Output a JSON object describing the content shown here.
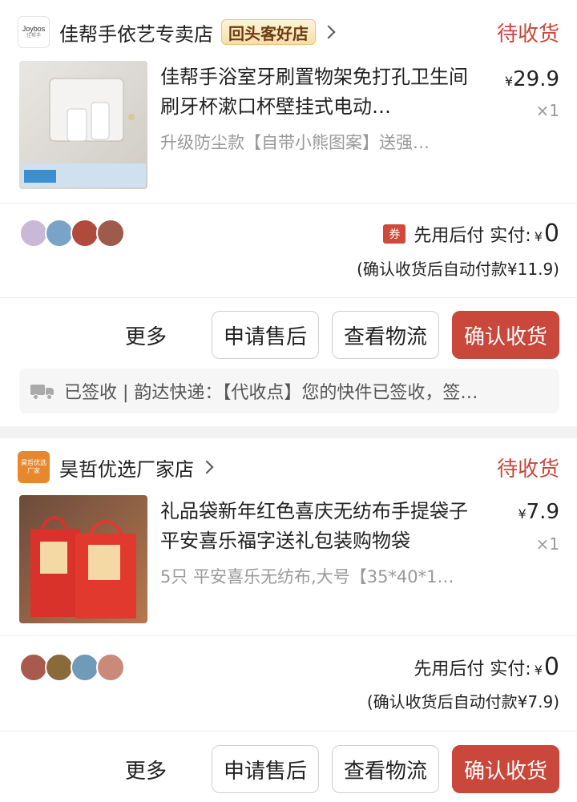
{
  "orders": [
    {
      "store": {
        "name": "佳帮手依艺专卖店",
        "badge": "回头客好店",
        "logo_text": "Joybos",
        "logo_sub": "佳帮手"
      },
      "status": "待收货",
      "product": {
        "title": "佳帮手浴室牙刷置物架免打孔卫生间刷牙杯漱口杯壁挂式电动…",
        "spec": "升级防尘款【自带小熊图案】送强…",
        "price_symbol": "¥",
        "price": "29.9",
        "quantity": "×1"
      },
      "avatar_colors": [
        "#c9b8d6",
        "#7aa3c8",
        "#b04a3a",
        "#9e5a4a"
      ],
      "payment": {
        "coupon_label": "券",
        "label": "先用后付 实付:",
        "symbol": "¥",
        "amount": "0",
        "auto_pay_note": "(确认收货后自动付款¥11.9)"
      },
      "actions": {
        "more": "更多",
        "after_sale": "申请售后",
        "logistics": "查看物流",
        "confirm": "确认收货"
      },
      "logistics_text": "已签收 | 韵达快递：【代收点】您的快件已签收，签…"
    },
    {
      "store": {
        "name": "昊哲优选厂家店",
        "logo_text": "昊哲优选",
        "logo_sub": "厂家"
      },
      "status": "待收货",
      "product": {
        "title": "礼品袋新年红色喜庆无纺布手提袋子平安喜乐福字送礼包装购物袋",
        "spec": "5只 平安喜乐无纺布,大号【35*40*1…",
        "price_symbol": "¥",
        "price": "7.9",
        "quantity": "×1"
      },
      "avatar_colors": [
        "#a85a4e",
        "#8a6a3a",
        "#6f9ab8",
        "#c98a7a"
      ],
      "payment": {
        "label": "先用后付 实付:",
        "symbol": "¥",
        "amount": "0",
        "auto_pay_note": "(确认收货后自动付款¥7.9)"
      },
      "actions": {
        "more": "更多",
        "after_sale": "申请售后",
        "logistics": "查看物流",
        "confirm": "确认收货"
      }
    }
  ]
}
